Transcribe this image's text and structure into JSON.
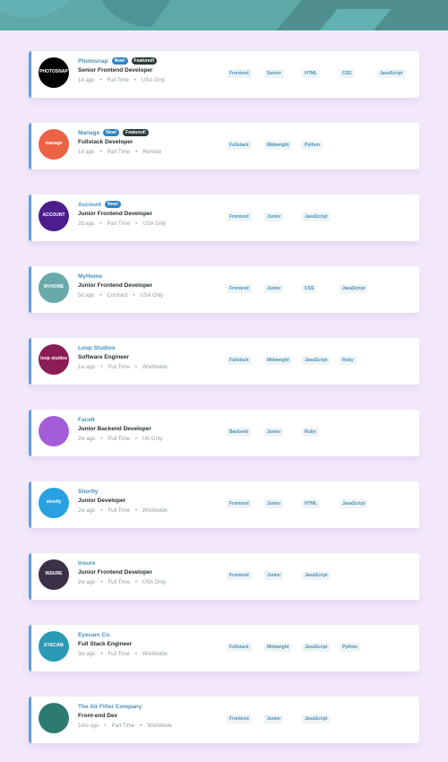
{
  "colors": {
    "background": "#f3e9fb",
    "header": "#5fa8a8",
    "accent": "#5b9fe0",
    "company": "#4a8fb8"
  },
  "jobs": [
    {
      "company": "Photosnap",
      "new": "New!",
      "featured": "Featured!",
      "position": "Senior Frontend Developer",
      "posted": "1d ago",
      "contract": "Full Time",
      "location": "USA Only",
      "logo_text": "PHOTOSNAP",
      "logo_color": "#000000",
      "tags": [
        "Frontend",
        "Senior",
        "HTML",
        "CSS",
        "JavaScript"
      ]
    },
    {
      "company": "Manage",
      "new": "New!",
      "featured": "Featured!",
      "position": "Fullstack Developer",
      "posted": "1d ago",
      "contract": "Part Time",
      "location": "Remote",
      "logo_text": "manage",
      "logo_color": "#ec6244",
      "tags": [
        "Fullstack",
        "Midweight",
        "Python"
      ]
    },
    {
      "company": "Account",
      "new": "New!",
      "featured": "",
      "position": "Junior Frontend Developer",
      "posted": "2d ago",
      "contract": "Part Time",
      "location": "USA Only",
      "logo_text": "ACCOUNT",
      "logo_color": "#4c1e8c",
      "tags": [
        "Frontend",
        "Junior",
        "JavaScript"
      ]
    },
    {
      "company": "MyHome",
      "new": "",
      "featured": "",
      "position": "Junior Frontend Developer",
      "posted": "5d ago",
      "contract": "Contract",
      "location": "USA Only",
      "logo_text": "MYHOME",
      "logo_color": "#6aa9a9",
      "tags": [
        "Frontend",
        "Junior",
        "CSS",
        "JavaScript"
      ]
    },
    {
      "company": "Loop Studios",
      "new": "",
      "featured": "",
      "position": "Software Engineer",
      "posted": "1w ago",
      "contract": "Full Time",
      "location": "Worldwide",
      "logo_text": "loop studios",
      "logo_color": "#8a1d55",
      "tags": [
        "Fullstack",
        "Midweight",
        "JavaScript",
        "Ruby"
      ]
    },
    {
      "company": "FaceIt",
      "new": "",
      "featured": "",
      "position": "Junior Backend Developer",
      "posted": "2w ago",
      "contract": "Full Time",
      "location": "UK Only",
      "logo_text": "",
      "logo_color": "#a35ed7",
      "tags": [
        "Backend",
        "Junior",
        "Ruby"
      ]
    },
    {
      "company": "Shortly",
      "new": "",
      "featured": "",
      "position": "Junior Developer",
      "posted": "2w ago",
      "contract": "Full Time",
      "location": "Worldwide",
      "logo_text": "shortly",
      "logo_color": "#27a1e0",
      "tags": [
        "Frontend",
        "Junior",
        "HTML",
        "JavaScript"
      ]
    },
    {
      "company": "Insure",
      "new": "",
      "featured": "",
      "position": "Junior Frontend Developer",
      "posted": "2w ago",
      "contract": "Full Time",
      "location": "USA Only",
      "logo_text": "INSURE",
      "logo_color": "#3a3147",
      "tags": [
        "Frontend",
        "Junior",
        "JavaScript"
      ]
    },
    {
      "company": "Eyecam Co.",
      "new": "",
      "featured": "",
      "position": "Full Stack Engineer",
      "posted": "3w ago",
      "contract": "Full Time",
      "location": "Worldwide",
      "logo_text": "EYECAM",
      "logo_color": "#2a9ab5",
      "tags": [
        "Fullstack",
        "Midweight",
        "JavaScript",
        "Python"
      ]
    },
    {
      "company": "The Air Filter Company",
      "new": "",
      "featured": "",
      "position": "Front-end Dev",
      "posted": "1mo ago",
      "contract": "Part Time",
      "location": "Worldwide",
      "logo_text": "",
      "logo_color": "#2d7a70",
      "tags": [
        "Frontend",
        "Junior",
        "JavaScript"
      ]
    }
  ]
}
